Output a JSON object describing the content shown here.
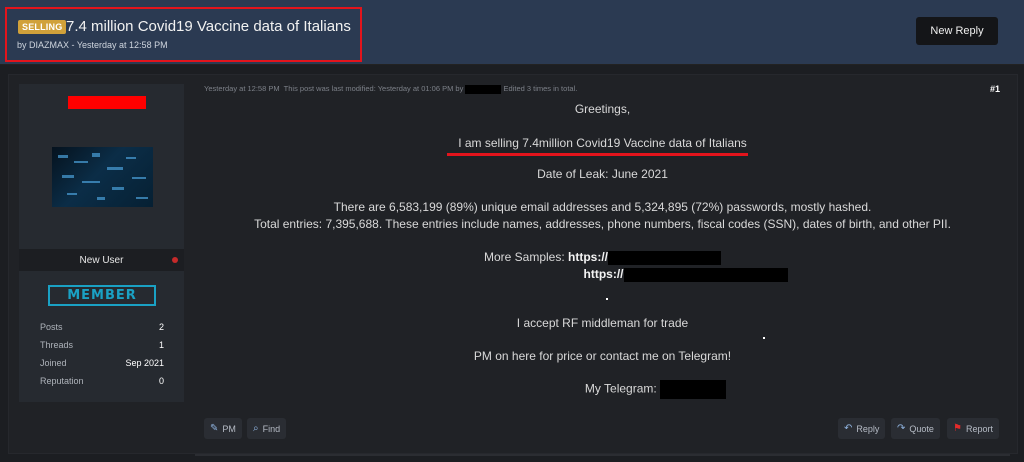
{
  "header": {
    "prefix_badge": "SELLING",
    "thread_title": "7.4 million Covid19 Vaccine data of Italians",
    "thread_meta": "by DIAZMAX - Yesterday at 12:58 PM",
    "new_reply_label": "New Reply"
  },
  "sidebar": {
    "role": "New User",
    "badge": "MEMBER",
    "stats": [
      {
        "label": "Posts",
        "value": "2"
      },
      {
        "label": "Threads",
        "value": "1"
      },
      {
        "label": "Joined",
        "value": "Sep 2021"
      },
      {
        "label": "Reputation",
        "value": "0"
      }
    ]
  },
  "post": {
    "time": "Yesterday at 12:58 PM",
    "modified_prefix": "This post was last modified: Yesterday at 01:06 PM by",
    "edited": "Edited 3 times in total.",
    "number": "#1",
    "lines": {
      "greeting": "Greetings,",
      "selling": "I am selling 7.4million Covid19 Vaccine data of Italians",
      "date_of_leak": "Date of Leak: June 2021",
      "emails": "There are 6,583,199 (89%) unique email addresses and 5,324,895 (72%) passwords, mostly hashed.",
      "entries": "Total entries: 7,395,688. These entries include names, addresses, phone numbers, fiscal codes (SSN), dates of birth, and other PII.",
      "samples_label": "More Samples:",
      "https": "https://",
      "middleman": "I accept RF middleman for trade",
      "pm": "PM on here for price or contact me on Telegram!",
      "telegram": "My Telegram:"
    }
  },
  "actions": {
    "pm": "PM",
    "find": "Find",
    "reply": "Reply",
    "quote": "Quote",
    "report": "Report"
  },
  "icons": {
    "pm": "pm-icon",
    "find": "search-icon",
    "reply": "reply-icon",
    "quote": "quote-icon",
    "report": "flag-icon"
  },
  "colors": {
    "header_bg": "#2b3a52",
    "highlight_red": "#e3141c",
    "badge_gold": "#d1a13a",
    "member_cyan": "#1aa1c4"
  }
}
